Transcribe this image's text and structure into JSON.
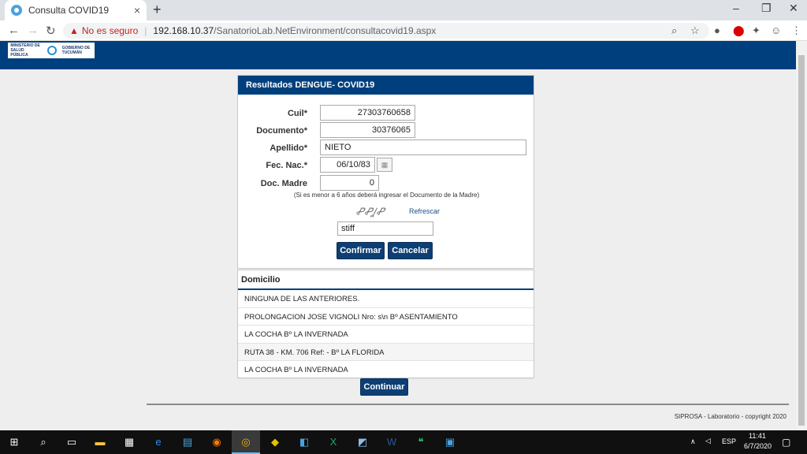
{
  "browser": {
    "tab_title": "Consulta COVID19",
    "tab_close": "×",
    "new_tab": "+",
    "not_secure": "No es seguro",
    "url_host": "192.168.10.37",
    "url_path": "/SanatorioLab.NetEnvironment/consultacovid19.aspx",
    "window_controls": [
      "–",
      "❐",
      "✕"
    ]
  },
  "header": {
    "logo_left": "MINISTERIO DE SALUD PÚBLICA",
    "logo_right": "GOBIERNO DE TUCUMÁN"
  },
  "form": {
    "title": "Resultados DENGUE- COVID19",
    "cuil_label": "Cuil*",
    "cuil_value": "27303760658",
    "documento_label": "Documento*",
    "documento_value": "30376065",
    "apellido_label": "Apellido*",
    "apellido_value": "NIETO",
    "fecnac_label": "Fec. Nac.*",
    "fecnac_value": "06/10/83",
    "docmadre_label": "Doc. Madre",
    "docmadre_value": "0",
    "hint": "(Si es menor a 6 años deberá ingresar el Documento de la Madre)",
    "captcha_text": "ꝒꝒꞲꝒ",
    "refresh_label": "Refrescar",
    "captcha_input": "stiff",
    "confirm_label": "Confirmar",
    "cancel_label": "Cancelar"
  },
  "domicilio": {
    "title": "Domicilio",
    "items": [
      "NINGUNA DE LAS ANTERIORES.",
      "PROLONGACION JOSE VIGNOLI Nro: s\\n Bº ASENTAMIENTO",
      "LA COCHA Bº LA INVERNADA",
      "RUTA 38 - KM. 706 Ref: - Bº LA FLORIDA",
      "LA COCHA Bº LA INVERNADA"
    ],
    "continue_label": "Continuar"
  },
  "footer": {
    "copyright": "SIPROSA - Laboratorio - copyright 2020"
  },
  "taskbar": {
    "lang": "ESP",
    "time": "11:41",
    "date": "6/7/2020"
  },
  "colors": {
    "brand_blue": "#003f7d",
    "button_blue": "#0e3f74",
    "warning_red": "#c5221f"
  }
}
